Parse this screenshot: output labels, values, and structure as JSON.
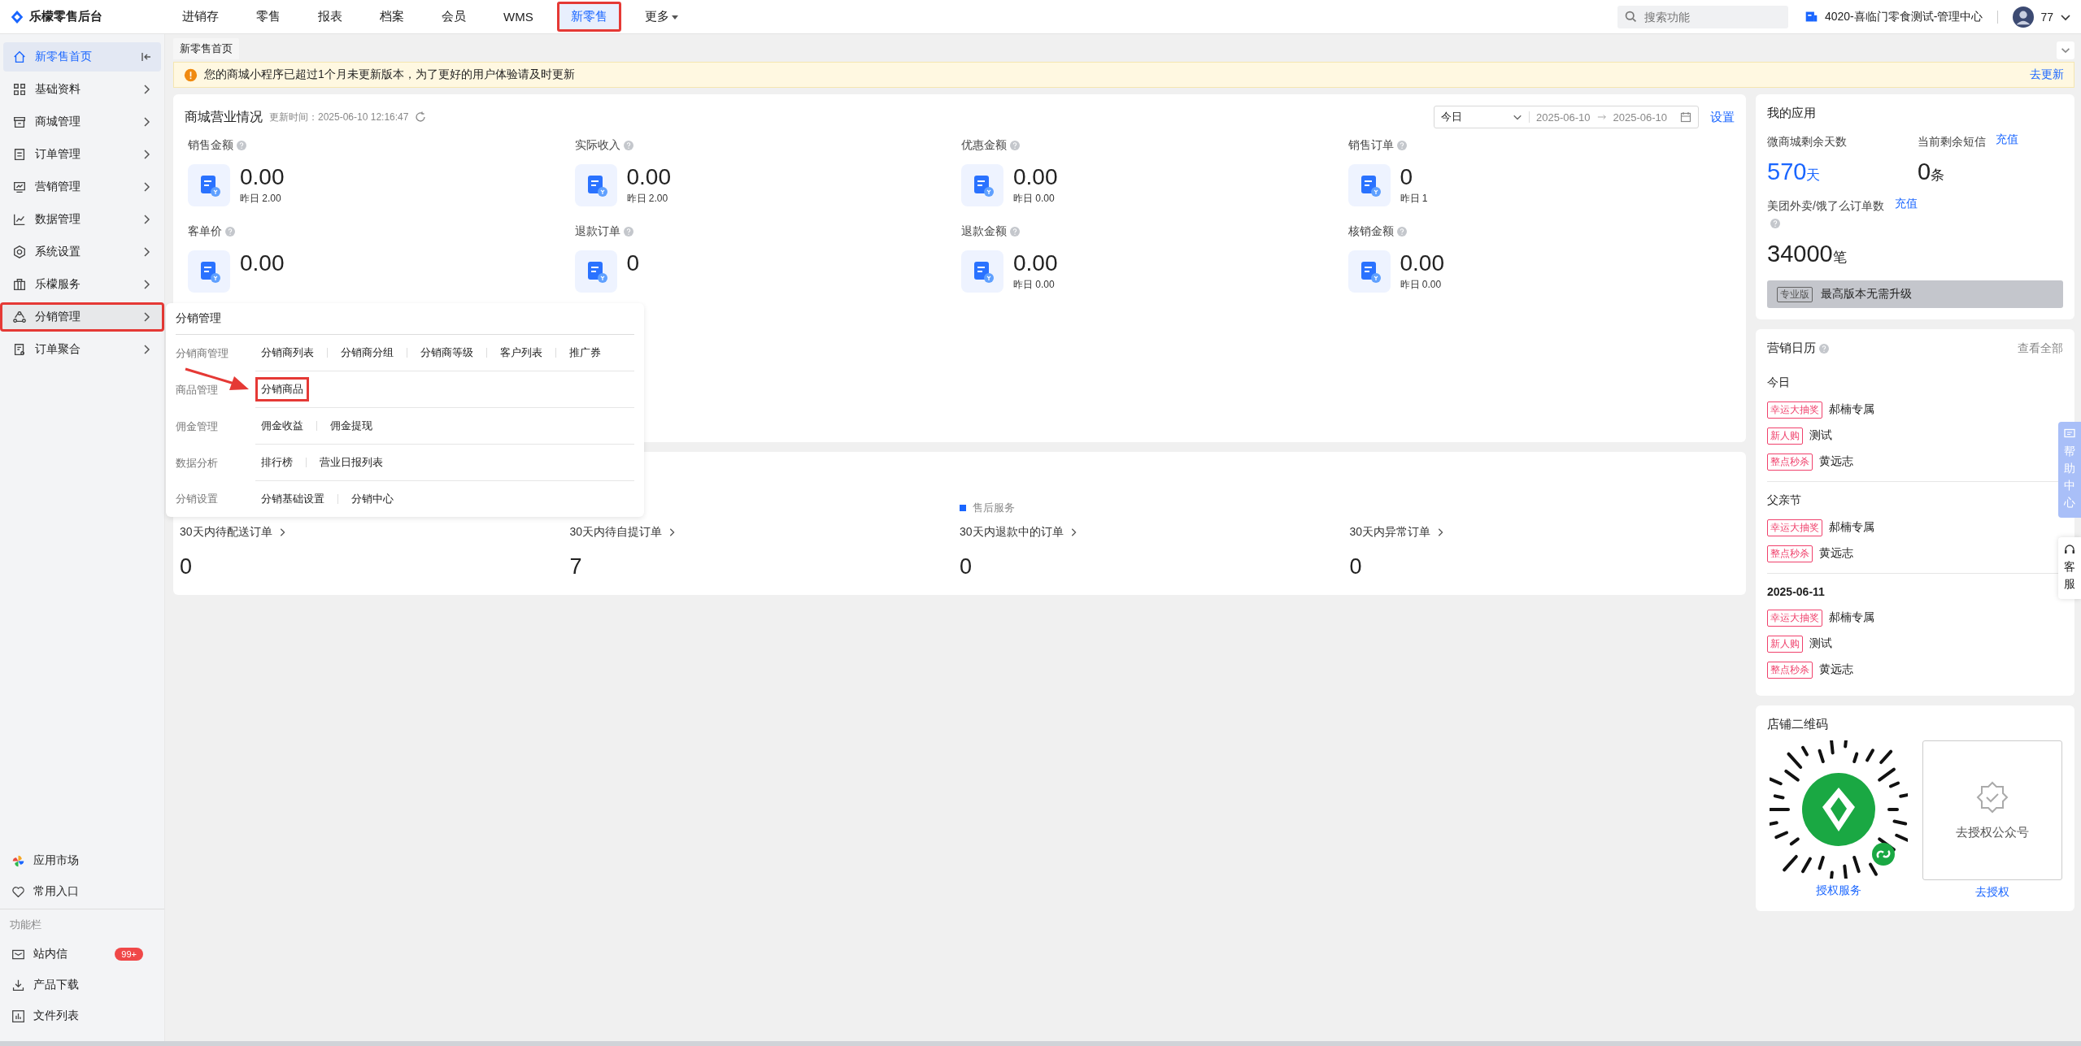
{
  "app": {
    "name": "乐檬零售后台"
  },
  "nav": [
    {
      "label": "进销存",
      "selected": false,
      "marked": false,
      "kind": "link"
    },
    {
      "label": "零售",
      "selected": false,
      "marked": false,
      "kind": "link"
    },
    {
      "label": "报表",
      "selected": false,
      "marked": false,
      "kind": "link"
    },
    {
      "label": "档案",
      "selected": false,
      "marked": false,
      "kind": "link"
    },
    {
      "label": "会员",
      "selected": false,
      "marked": false,
      "kind": "link"
    },
    {
      "label": "WMS",
      "selected": false,
      "marked": false,
      "kind": "link"
    },
    {
      "label": "新零售",
      "selected": true,
      "marked": true,
      "kind": "link"
    },
    {
      "label": "更多",
      "selected": false,
      "marked": false,
      "kind": "menu"
    }
  ],
  "search": {
    "placeholder": "搜索功能"
  },
  "store": "4020-喜临门零食测试-管理中心",
  "user": {
    "name": "77"
  },
  "sidebar": {
    "items": [
      {
        "label": "新零售首页",
        "selected": true,
        "hovered": false,
        "marked": false,
        "kind": "pinned"
      },
      {
        "label": "基础资料",
        "selected": false,
        "hovered": false,
        "marked": false,
        "kind": "submenu"
      },
      {
        "label": "商城管理",
        "selected": false,
        "hovered": false,
        "marked": false,
        "kind": "submenu"
      },
      {
        "label": "订单管理",
        "selected": false,
        "hovered": false,
        "marked": false,
        "kind": "submenu"
      },
      {
        "label": "营销管理",
        "selected": false,
        "hovered": false,
        "marked": false,
        "kind": "submenu"
      },
      {
        "label": "数据管理",
        "selected": false,
        "hovered": false,
        "marked": false,
        "kind": "submenu"
      },
      {
        "label": "系统设置",
        "selected": false,
        "hovered": false,
        "marked": false,
        "kind": "submenu"
      },
      {
        "label": "乐檬服务",
        "selected": false,
        "hovered": false,
        "marked": false,
        "kind": "submenu"
      },
      {
        "label": "分销管理",
        "selected": false,
        "hovered": true,
        "marked": true,
        "kind": "submenu"
      },
      {
        "label": "订单聚合",
        "selected": false,
        "hovered": false,
        "marked": false,
        "kind": "submenu"
      }
    ],
    "shortcuts": [
      {
        "label": "应用市场"
      },
      {
        "label": "常用入口"
      }
    ],
    "section_label": "功能栏",
    "tools": [
      {
        "label": "站内信",
        "badge": "99+"
      },
      {
        "label": "产品下载"
      },
      {
        "label": "文件列表"
      }
    ]
  },
  "page_tabs": [
    {
      "label": "新零售首页"
    }
  ],
  "notice": {
    "text": "您的商城小程序已超过1个月未更新版本，为了更好的用户体验请及时更新",
    "action": "去更新"
  },
  "overview": {
    "title": "商城营业情况",
    "updated": "更新时间：2025-06-10 12:16:47",
    "period": "今日",
    "date_from": "2025-06-10",
    "date_to": "2025-06-10",
    "settings": "设置",
    "stats": [
      {
        "label": "销售金额",
        "value": "0.00",
        "yesterday": "昨日 2.00"
      },
      {
        "label": "实际收入",
        "value": "0.00",
        "yesterday": "昨日 2.00"
      },
      {
        "label": "优惠金额",
        "value": "0.00",
        "yesterday": "昨日 0.00"
      },
      {
        "label": "销售订单",
        "value": "0",
        "yesterday": "昨日 1"
      },
      {
        "label": "客单价",
        "value": "0.00"
      },
      {
        "label": "退款订单",
        "value": "0"
      },
      {
        "label": "退款金额",
        "value": "0.00",
        "yesterday": "昨日 0.00"
      },
      {
        "label": "核销金额",
        "value": "0.00",
        "yesterday": "昨日 0.00"
      }
    ]
  },
  "orders": {
    "items": [
      {
        "label": "30天内待配送订单",
        "value": "0"
      },
      {
        "label": "30天内待自提订单",
        "value": "7"
      },
      {
        "group": "售后服务",
        "label": "30天内退款中的订单",
        "value": "0"
      },
      {
        "label": "30天内异常订单",
        "value": "0"
      }
    ]
  },
  "apps": {
    "title": "我的应用",
    "metrics": [
      {
        "label": "微商城剩余天数",
        "value": "570",
        "unit": "天",
        "highlight": true,
        "help": false
      },
      {
        "label": "当前剩余短信",
        "action": "充值",
        "value": "0",
        "unit": "条",
        "highlight": false,
        "help": false
      },
      {
        "label": "美团外卖/饿了么订单数",
        "action": "充值",
        "value": "34000",
        "unit": "笔",
        "highlight": false,
        "help": true
      }
    ],
    "edition": {
      "tag": "专业版",
      "text": "最高版本无需升级"
    }
  },
  "calendar": {
    "title": "营销日历",
    "more": "查看全部",
    "groups": [
      {
        "title": "今日",
        "kind": "day",
        "events": [
          {
            "tag": "幸运大抽奖",
            "text": "郝楠专属"
          },
          {
            "tag": "新人购",
            "text": "测试"
          },
          {
            "tag": "整点秒杀",
            "text": "黄远志"
          }
        ]
      },
      {
        "title": "父亲节",
        "kind": "day",
        "events": [
          {
            "tag": "幸运大抽奖",
            "text": "郝楠专属"
          },
          {
            "tag": "整点秒杀",
            "text": "黄远志"
          }
        ]
      },
      {
        "title": "2025-06-11",
        "kind": "date",
        "events": [
          {
            "tag": "幸运大抽奖",
            "text": "郝楠专属"
          },
          {
            "tag": "新人购",
            "text": "测试"
          },
          {
            "tag": "整点秒杀",
            "text": "黄远志"
          }
        ]
      }
    ]
  },
  "qr": {
    "title": "店铺二维码",
    "link": "授权服务",
    "auth_text": "去授权公众号",
    "auth_link": "去授权"
  },
  "float_tabs": [
    {
      "label": "帮助中心",
      "kind": "help"
    },
    {
      "label": "客服",
      "kind": "service"
    }
  ],
  "popup": {
    "title": "分销管理",
    "groups": [
      {
        "label": "分销商管理",
        "links": [
          {
            "label": "分销商列表",
            "marked": false
          },
          {
            "label": "分销商分组",
            "marked": false
          },
          {
            "label": "分销商等级",
            "marked": false
          },
          {
            "label": "客户列表",
            "marked": false
          },
          {
            "label": "推广券",
            "marked": false
          }
        ]
      },
      {
        "label": "商品管理",
        "links": [
          {
            "label": "分销商品",
            "marked": true
          }
        ]
      },
      {
        "label": "佣金管理",
        "links": [
          {
            "label": "佣金收益",
            "marked": false
          },
          {
            "label": "佣金提现",
            "marked": false
          }
        ]
      },
      {
        "label": "数据分析",
        "links": [
          {
            "label": "排行榜",
            "marked": false
          },
          {
            "label": "营业日报列表",
            "marked": false
          }
        ]
      },
      {
        "label": "分销设置",
        "links": [
          {
            "label": "分销基础设置",
            "marked": false
          },
          {
            "label": "分销中心",
            "marked": false
          }
        ]
      }
    ]
  }
}
